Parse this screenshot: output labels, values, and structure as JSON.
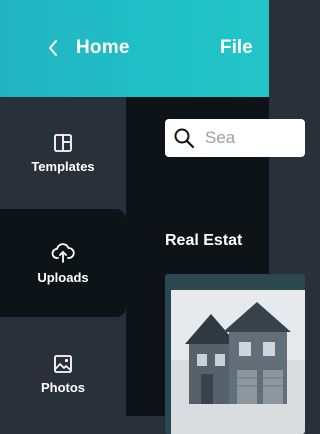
{
  "header": {
    "back_label": "Home",
    "file_label": "File"
  },
  "sidebar": {
    "items": [
      {
        "label": "Templates",
        "icon": "templates-icon"
      },
      {
        "label": "Uploads",
        "icon": "upload-cloud-icon"
      },
      {
        "label": "Photos",
        "icon": "photo-icon"
      }
    ],
    "active": "Uploads"
  },
  "panel": {
    "search_placeholder": "Sea",
    "section_title": "Real Estat"
  },
  "colors": {
    "header_teal": "#23b4c4",
    "sidebar_bg": "#293039",
    "panel_bg": "#0e1318"
  }
}
